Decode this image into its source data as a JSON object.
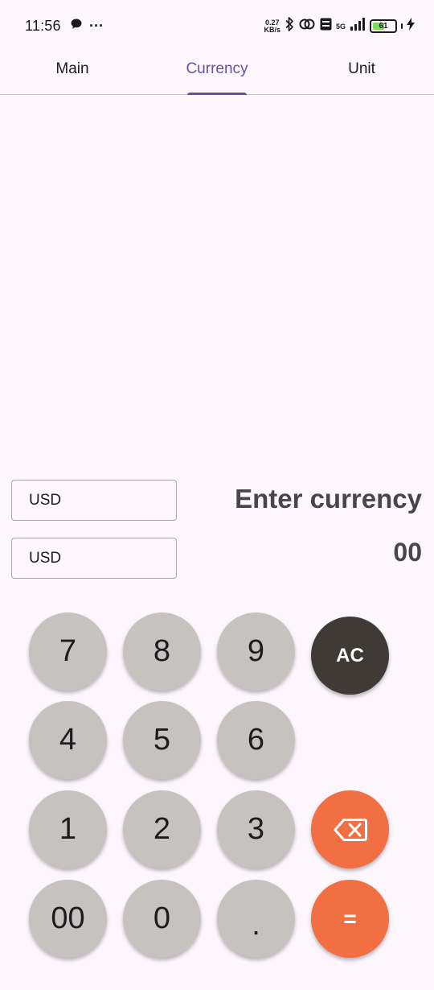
{
  "status_bar": {
    "time": "11:56",
    "left_icons": [
      "chat-bubble-icon",
      "more-dots-icon"
    ],
    "more_glyph": "···",
    "speed_value": "0.27",
    "speed_unit": "KB/s",
    "network_label": "5G",
    "battery_level": "61",
    "icons": [
      "bluetooth-icon",
      "link-icon",
      "volte-icon",
      "signal-icon",
      "battery-icon",
      "charging-icon"
    ]
  },
  "tabs": [
    {
      "label": "Main",
      "active": false
    },
    {
      "label": "Currency",
      "active": true
    },
    {
      "label": "Unit",
      "active": false
    }
  ],
  "converter": {
    "from_currency": "USD",
    "to_currency": "USD",
    "prompt": "Enter currency",
    "result": "00"
  },
  "keypad": {
    "keys": [
      {
        "label": "7"
      },
      {
        "label": "8"
      },
      {
        "label": "9"
      },
      {
        "label": "AC"
      },
      {
        "label": "4"
      },
      {
        "label": "5"
      },
      {
        "label": "6"
      },
      {
        "label": "1"
      },
      {
        "label": "2"
      },
      {
        "label": "3"
      },
      {
        "label": "backspace",
        "icon": "backspace-icon"
      },
      {
        "label": "00"
      },
      {
        "label": "0"
      },
      {
        "label": "."
      },
      {
        "label": "="
      }
    ]
  },
  "colors": {
    "background": "#fdf7fd",
    "accent_tab": "#6750a4",
    "number_key": "#c5c2bf",
    "clear_key": "#3f3a36",
    "action_key": "#f26e43",
    "battery_fill": "#7ed957"
  }
}
